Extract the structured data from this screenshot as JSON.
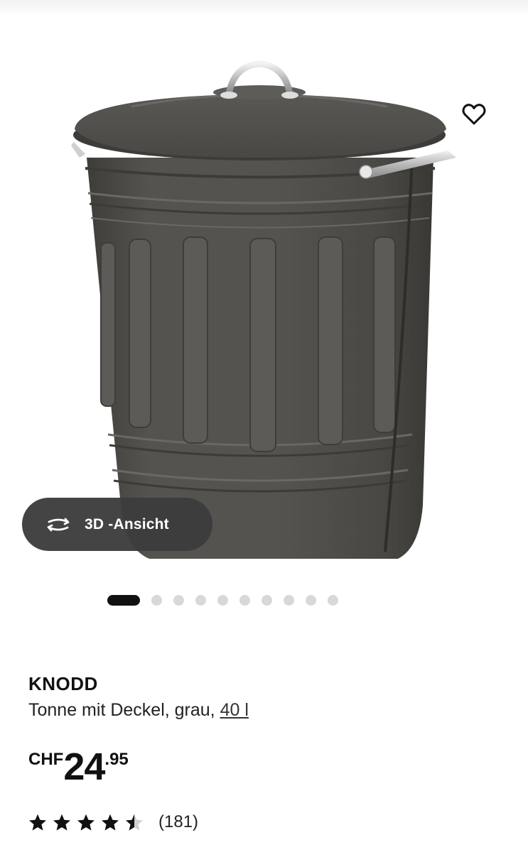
{
  "gallery": {
    "image_alt": "KNODD Tonne mit Deckel, grau, 40 l",
    "view3d_label": "3D -Ansicht",
    "slide_count": 10,
    "active_slide": 1,
    "favorite_icon": "heart-outline-icon"
  },
  "product": {
    "name": "KNODD",
    "description": "Tonne mit Deckel, grau, ",
    "size_link": "40 l"
  },
  "price": {
    "currency": "CHF",
    "integer": "24",
    "decimal": ".95"
  },
  "rating": {
    "value": 4.5,
    "max": 5,
    "count_label": "(181)"
  },
  "colors": {
    "bin_body": "#4e4c48",
    "pill_bg": "#3c3c3c",
    "text": "#111111",
    "dot_inactive": "#d8d8d8"
  }
}
